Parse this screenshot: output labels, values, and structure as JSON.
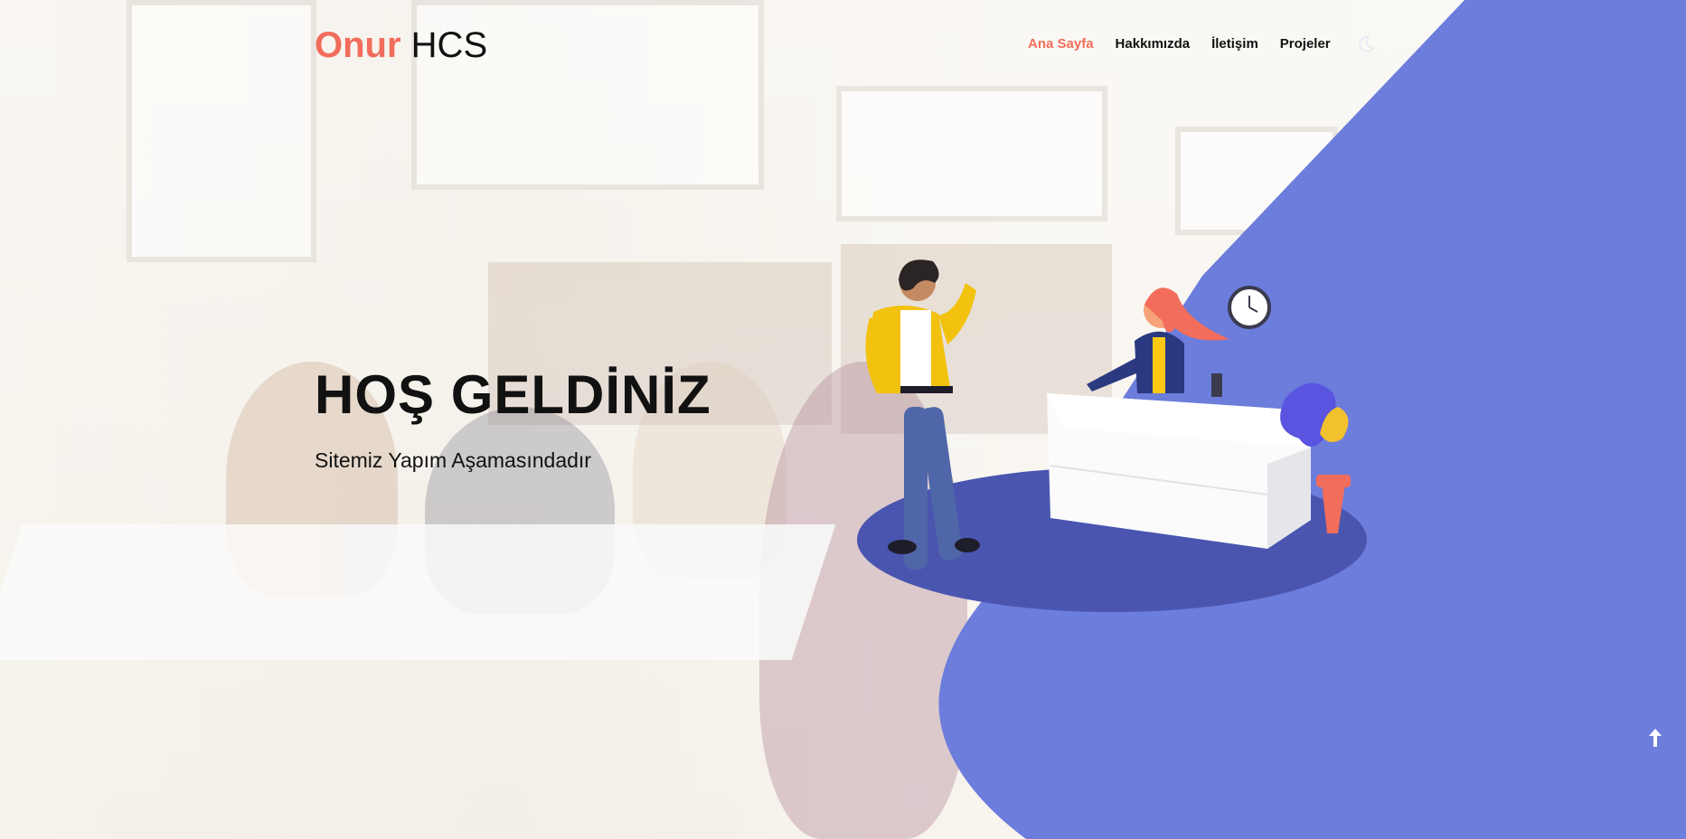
{
  "brand": {
    "accent": "Onur",
    "rest": "HCS"
  },
  "nav": {
    "items": [
      {
        "label": "Ana Sayfa",
        "active": true
      },
      {
        "label": "Hakkımızda",
        "active": false
      },
      {
        "label": "İletişim",
        "active": false
      },
      {
        "label": "Projeler",
        "active": false
      }
    ],
    "theme_toggle_icon": "moon-icon"
  },
  "hero": {
    "title": "HOŞ GELDİNİZ",
    "subtitle": "Sitemiz Yapım Aşamasındadır"
  },
  "scroll_top_icon": "arrow-up-icon",
  "colors": {
    "accent": "#f26d5b",
    "blob": "#6c7ddc",
    "platform": "#4a55b0",
    "text": "#111111"
  }
}
